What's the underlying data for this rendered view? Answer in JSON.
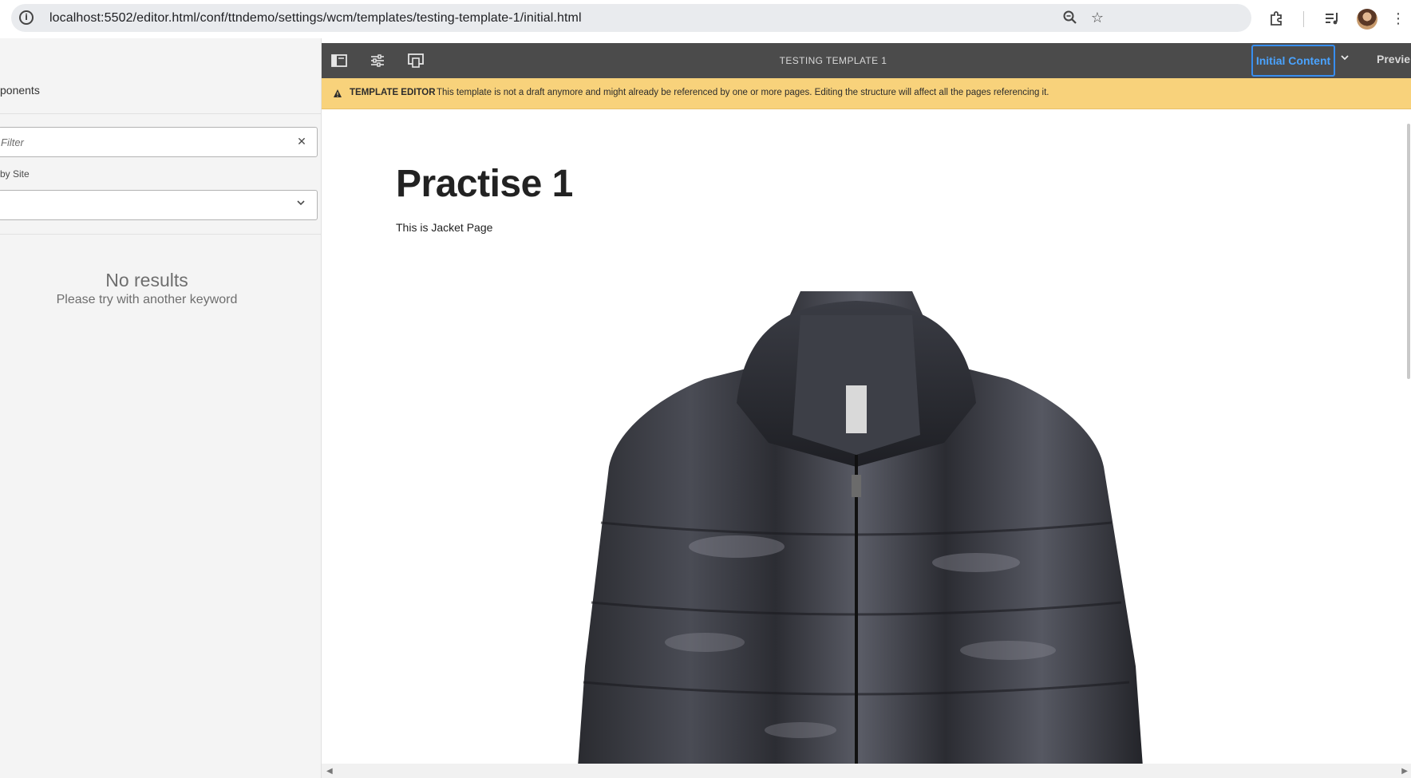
{
  "browser": {
    "url": "localhost:5502/editor.html/conf/ttndemo/settings/wcm/templates/testing-template-1/initial.html",
    "icons": [
      "site-info-icon",
      "zoom-icon",
      "bookmark-star-icon",
      "extensions-icon",
      "media-controls-icon",
      "profile-avatar",
      "more-menu-icon"
    ]
  },
  "side_panel": {
    "tab_label": "ponents",
    "filter_placeholder": "Filter",
    "site_label": "by Site",
    "site_value": "",
    "no_results_title": "No results",
    "no_results_sub": "Please try with another keyword"
  },
  "toolbar": {
    "icons": [
      "toggle-side-panel-icon",
      "page-properties-icon",
      "emulator-icon"
    ],
    "title": "TESTING TEMPLATE 1",
    "mode_label": "Initial Content",
    "preview_label": "Previe"
  },
  "alert": {
    "type_label": "TEMPLATE EDITOR",
    "message": "This template is not a draft anymore and might already be referenced by one or more pages. Editing the structure will affect all the pages referencing it.",
    "color": "#f8d27b"
  },
  "page": {
    "title": "Practise 1",
    "text": "This is Jacket Page"
  },
  "colors": {
    "toolbar_bg": "#4b4b4b",
    "accent": "#378ef0"
  }
}
